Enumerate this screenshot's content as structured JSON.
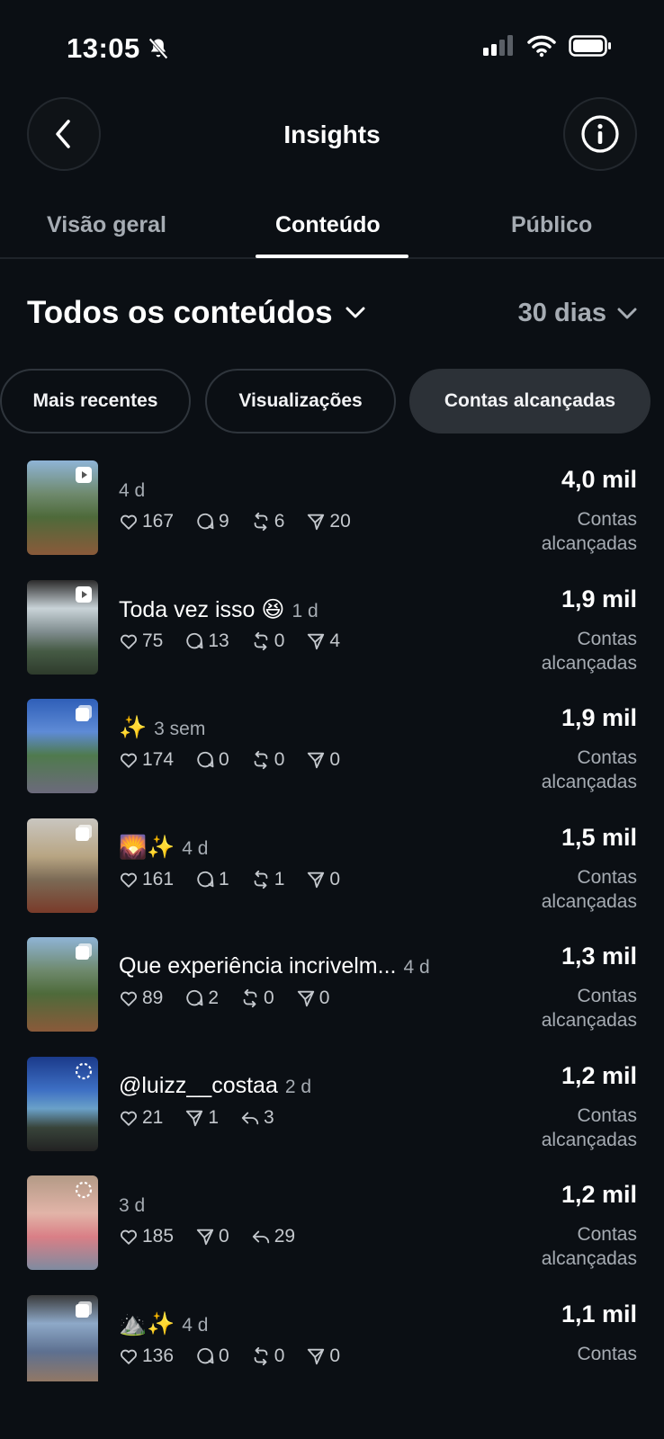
{
  "status_bar": {
    "time": "13:05"
  },
  "header": {
    "title": "Insights"
  },
  "tabs": [
    {
      "label": "Visão geral"
    },
    {
      "label": "Conteúdo",
      "active": true
    },
    {
      "label": "Público"
    }
  ],
  "filter": {
    "title": "Todos os conteúdos",
    "period": "30 dias"
  },
  "chips": [
    {
      "label": "Mais recentes"
    },
    {
      "label": "Visualizações"
    },
    {
      "label": "Contas alcançadas",
      "selected": true
    }
  ],
  "metric_label": "Contas alcançadas",
  "posts": [
    {
      "caption": "",
      "age": "4 d",
      "type": "reel",
      "stats": {
        "likes": "167",
        "comments": "9",
        "reposts": "6",
        "shares": "20"
      },
      "metric": "4,0 mil"
    },
    {
      "caption": "Toda vez isso 😆",
      "age": "1 d",
      "type": "reel",
      "stats": {
        "likes": "75",
        "comments": "13",
        "reposts": "0",
        "shares": "4"
      },
      "metric": "1,9 mil"
    },
    {
      "caption": "✨",
      "age": "3 sem",
      "type": "carousel",
      "stats": {
        "likes": "174",
        "comments": "0",
        "reposts": "0",
        "shares": "0"
      },
      "metric": "1,9 mil"
    },
    {
      "caption": "🌄✨",
      "age": "4 d",
      "type": "carousel",
      "stats": {
        "likes": "161",
        "comments": "1",
        "reposts": "1",
        "shares": "0"
      },
      "metric": "1,5 mil"
    },
    {
      "caption": "Que experiência incrivelm...",
      "age": "4 d",
      "type": "carousel",
      "stats": {
        "likes": "89",
        "comments": "2",
        "reposts": "0",
        "shares": "0"
      },
      "metric": "1,3 mil"
    },
    {
      "caption": "@luizz__costaa",
      "age": "2 d",
      "type": "story",
      "stats": {
        "likes": "21",
        "shares": "1",
        "replies": "3"
      },
      "metric": "1,2 mil"
    },
    {
      "caption": "",
      "age": "3 d",
      "type": "story",
      "stats": {
        "likes": "185",
        "shares": "0",
        "replies": "29"
      },
      "metric": "1,2 mil"
    },
    {
      "caption": "⛰️✨",
      "age": "4 d",
      "type": "carousel",
      "stats": {
        "likes": "136",
        "comments": "0",
        "reposts": "0",
        "shares": "0"
      },
      "metric": "1,1 mil",
      "metric_label": "Contas"
    }
  ],
  "colors": {
    "background": "#0b0f14",
    "muted_text": "#a6acb3",
    "chip_selected": "#2c3137"
  },
  "icons": [
    "back-icon",
    "info-icon",
    "chevron-down-icon",
    "heart-icon",
    "comment-icon",
    "repost-icon",
    "share-icon",
    "reply-icon",
    "reel-icon",
    "carousel-icon",
    "story-icon"
  ]
}
